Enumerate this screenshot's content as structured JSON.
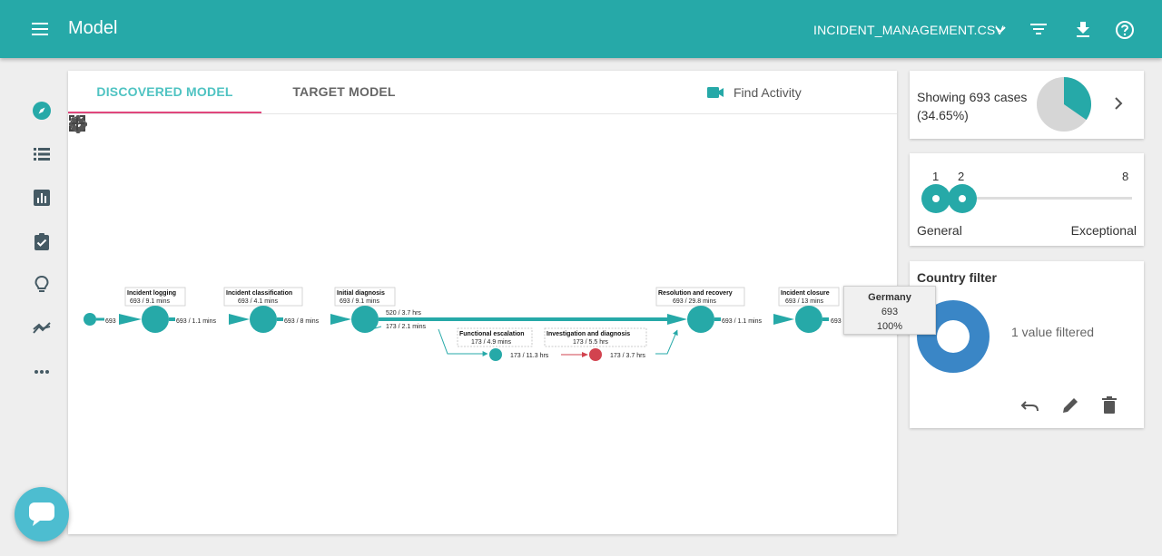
{
  "header": {
    "title": "Model",
    "file_name": "INCIDENT_MANAGEMENT.CSV"
  },
  "tabs": {
    "discovered": "DISCOVERED MODEL",
    "target": "TARGET MODEL",
    "find_activity": "Find Activity"
  },
  "process_map": {
    "start_count": "693",
    "nodes": [
      {
        "name": "Incident logging",
        "stats": "693 / 9.1 mins"
      },
      {
        "name": "Incident classification",
        "stats": "693 / 4.1 mins"
      },
      {
        "name": "Initial diagnosis",
        "stats": "693 / 9.1 mins"
      },
      {
        "name": "Functional escalation",
        "stats": "173 / 4.9 mins"
      },
      {
        "name": "Investigation and diagnosis",
        "stats": "173 / 5.5 hrs"
      },
      {
        "name": "Resolution and recovery",
        "stats": "693 / 29.8 mins"
      },
      {
        "name": "Incident closure",
        "stats": "693 / 13 mins"
      }
    ],
    "edges": [
      "693 / 1.1 mins",
      "693 / 8 mins",
      "520 / 3.7 hrs",
      "173 / 2.1 mins",
      "173 / 11.3 hrs",
      "173 / 3.7 hrs",
      "693 / 1.1 mins",
      "693"
    ],
    "tooltip": {
      "name": "Germany",
      "count": "693",
      "percent": "100%"
    }
  },
  "cases_card": {
    "text": "Showing 693 cases (34.65%)",
    "fraction": 0.3465
  },
  "variant_slider": {
    "ticks": [
      "1",
      "2",
      "8"
    ],
    "low_label": "General",
    "high_label": "Exceptional"
  },
  "country_filter": {
    "title": "Country filter",
    "status": "1 value filtered"
  },
  "colors": {
    "primary": "#26a9a8",
    "tab_accent": "#e0467c",
    "donut": "#3a86c6",
    "warn_node": "#d2434f"
  }
}
